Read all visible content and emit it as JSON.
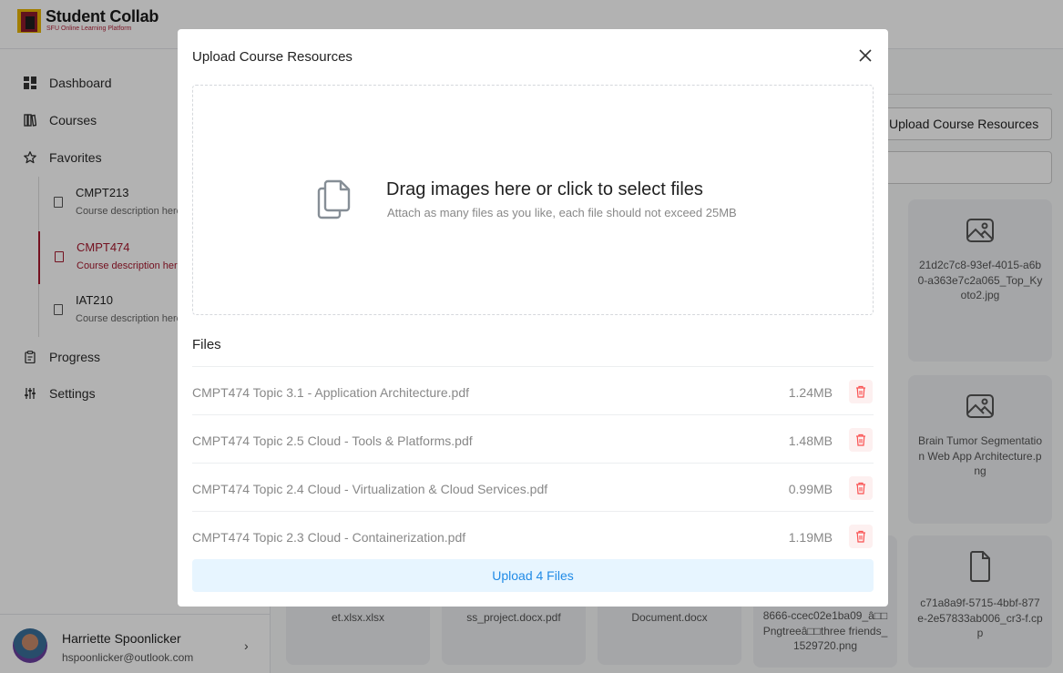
{
  "app": {
    "name": "Student Collab",
    "subtitle": "SFU Online Learning Platform"
  },
  "sidebar": {
    "nav": [
      {
        "label": "Dashboard",
        "icon": "dashboard-icon"
      },
      {
        "label": "Courses",
        "icon": "books-icon"
      },
      {
        "label": "Favorites",
        "icon": "star-icon"
      },
      {
        "label": "Progress",
        "icon": "clipboard-icon"
      },
      {
        "label": "Settings",
        "icon": "sliders-icon"
      }
    ],
    "favorites": [
      {
        "title": "CMPT213",
        "desc": "Course description here",
        "active": false
      },
      {
        "title": "CMPT474",
        "desc": "Course description here",
        "active": true
      },
      {
        "title": "IAT210",
        "desc": "Course description here",
        "active": false
      }
    ],
    "user": {
      "name": "Harriette Spoonlicker",
      "email": "hspoonlicker@outlook.com"
    }
  },
  "main": {
    "upload_button": "Upload Course Resources",
    "cards": [
      {
        "name": "21d2c7c8-93ef-4015-a6b0-a363e7c2a065_Top_Kyoto2.jpg",
        "icon": "image-icon"
      },
      {
        "name": "Brain Tumor Segmentation Web App Architecture.png",
        "icon": "image-icon"
      },
      {
        "name": "c71a8a9f-5715-4bbf-877e-2e57833ab006_cr3-f.cpp",
        "icon": "file-icon"
      },
      {
        "name": "et.xlsx.xlsx",
        "icon": "file-icon"
      },
      {
        "name": "ss_project.docx.pdf",
        "icon": "file-icon"
      },
      {
        "name": "Document.docx",
        "icon": "file-icon"
      },
      {
        "name": "8666-ccec02e1ba09_â□□Pngtreeâ□□three friends_1529720.png",
        "icon": "image-icon"
      }
    ]
  },
  "modal": {
    "title": "Upload Course Resources",
    "dropzone": {
      "main": "Drag images here or click to select files",
      "sub": "Attach as many files as you like, each file should not exceed 25MB"
    },
    "files_label": "Files",
    "files": [
      {
        "name": "CMPT474 Topic 3.1 - Application Architecture.pdf",
        "size": "1.24MB"
      },
      {
        "name": "CMPT474 Topic 2.5 Cloud - Tools & Platforms.pdf",
        "size": "1.48MB"
      },
      {
        "name": "CMPT474 Topic 2.4 Cloud - Virtualization & Cloud Services.pdf",
        "size": "0.99MB"
      },
      {
        "name": "CMPT474 Topic 2.3 Cloud - Containerization.pdf",
        "size": "1.19MB"
      }
    ],
    "upload_label": "Upload 4 Files"
  },
  "colors": {
    "brand": "#a6192e",
    "accent": "#228be6",
    "danger": "#fa5252",
    "overlay": "rgba(0,0,0,0.30)"
  }
}
